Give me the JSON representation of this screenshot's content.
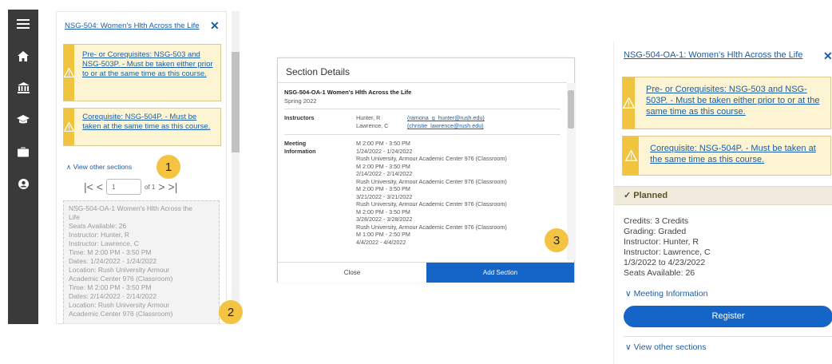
{
  "panel1": {
    "title": "NSG-504: Women's Hlth Across the Life",
    "close": "✕",
    "warning1": "Pre- or Corequisites: NSG-503 and NSG-503P. - Must be taken either prior to or at the same time as this course.",
    "warning2": "Corequisite: NSG-504P. - Must be taken at the same time as this course.",
    "view_other": "View other sections",
    "pager": {
      "value": "1",
      "of": "of 1"
    },
    "detail_lines": [
      "NSG-504-OA-1 Women's Hlth Across the",
      "Life",
      "Seats Available: 26",
      "Instructor: Hunter, R",
      "Instructor: Lawrence, C",
      "Time: M 2:00 PM - 3:50 PM",
      "Dates: 1/24/2022 - 1/24/2022",
      "Location: Rush University Armour",
      "Academic Center 976 (Classroom)",
      "Time: M 2:00 PM - 3:50 PM",
      "Dates: 2/14/2022 - 2/14/2022",
      "Location: Rush University Armour",
      "Academic Center 976 (Classroom)"
    ]
  },
  "badges": {
    "b1": "1",
    "b2": "2",
    "b3": "3"
  },
  "dialog": {
    "title": "Section Details",
    "course": "NSG-504-OA-1 Women's Hlth Across the Life",
    "term": "Spring 2022",
    "instructors_label": "Instructors",
    "instructors": [
      {
        "name": "Hunter, R",
        "email": "(ramona_g_hunter@rush.edu)"
      },
      {
        "name": "Lawrence, C",
        "email": "(christie_lawrence@rush.edu)"
      }
    ],
    "meeting_label_1": "Meeting",
    "meeting_label_2": "Information",
    "meeting_lines": [
      "M 2:00 PM - 3:50 PM",
      "1/24/2022 - 1/24/2022",
      "Rush University, Armour Academic Center 976 (Classroom)",
      "M 2:00 PM - 3:50 PM",
      "2/14/2022 - 2/14/2022",
      "Rush University, Armour Academic Center 976 (Classroom)",
      "M 2:00 PM - 3:50 PM",
      "3/21/2022 - 3/21/2022",
      "Rush University, Armour Academic Center 976 (Classroom)",
      "M 2:00 PM - 3:50 PM",
      "3/28/2022 - 3/28/2022",
      "Rush University, Armour Academic Center 976 (Classroom)",
      "M 1:00 PM - 2:50 PM",
      "4/4/2022 - 4/4/2022"
    ],
    "close_label": "Close",
    "add_label": "Add Section"
  },
  "panel3": {
    "title": "NSG-504-OA-1: Women's Hlth Across the Life",
    "close": "✕",
    "warning1": "Pre- or Corequisites: NSG-503 and NSG-503P. - Must be taken either prior to or at the same time as this course.",
    "warning2": "Corequisite: NSG-504P. - Must be taken at the same time as this course.",
    "planned": "Planned",
    "info_lines": [
      "Credits: 3 Credits",
      "Grading: Graded",
      "Instructor: Hunter, R",
      "Instructor: Lawrence, C",
      "1/3/2022 to 4/23/2022",
      "Seats Available:  26"
    ],
    "meeting_info": "Meeting Information",
    "register": "Register",
    "view_other": "View other sections"
  }
}
